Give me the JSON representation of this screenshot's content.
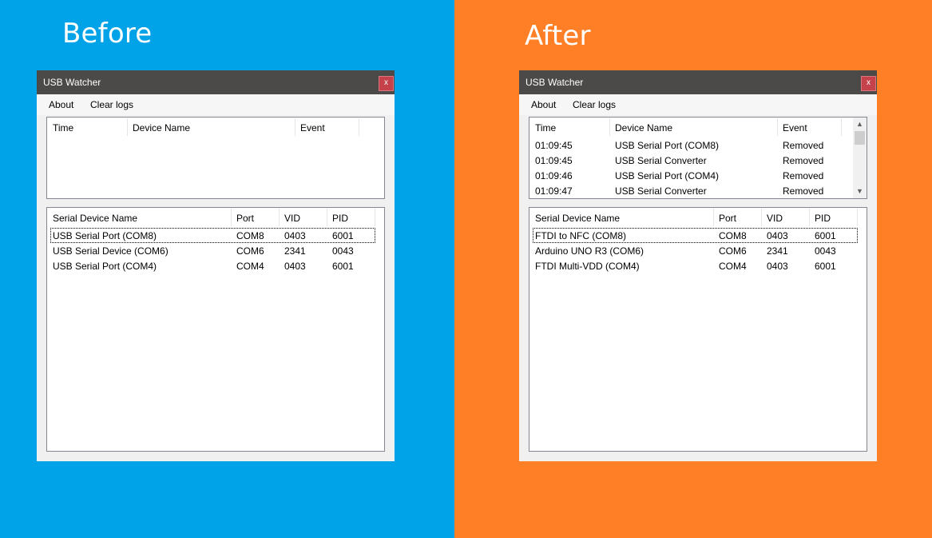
{
  "colors": {
    "before_bg": "#00a2e8",
    "after_bg": "#ff7f27",
    "titlebar": "#4b4a48",
    "close_button": "#c6424a"
  },
  "before": {
    "heading": "Before",
    "window": {
      "title": "USB Watcher",
      "close_label": "x",
      "menu": [
        "About",
        "Clear logs"
      ],
      "events": {
        "columns": [
          "Time",
          "Device Name",
          "Event"
        ],
        "rows": []
      },
      "devices": {
        "columns": [
          "Serial Device Name",
          "Port",
          "VID",
          "PID"
        ],
        "rows": [
          [
            "USB Serial Port (COM8)",
            "COM8",
            "0403",
            "6001"
          ],
          [
            "USB Serial Device (COM6)",
            "COM6",
            "2341",
            "0043"
          ],
          [
            "USB Serial Port (COM4)",
            "COM4",
            "0403",
            "6001"
          ]
        ]
      }
    }
  },
  "after": {
    "heading": "After",
    "window": {
      "title": "USB Watcher",
      "close_label": "x",
      "menu": [
        "About",
        "Clear logs"
      ],
      "events": {
        "columns": [
          "Time",
          "Device Name",
          "Event"
        ],
        "rows": [
          [
            "01:09:45",
            "USB Serial Port (COM8)",
            "Removed"
          ],
          [
            "01:09:45",
            "USB Serial Converter",
            "Removed"
          ],
          [
            "01:09:46",
            "USB Serial Port (COM4)",
            "Removed"
          ],
          [
            "01:09:47",
            "USB Serial Converter",
            "Removed"
          ]
        ],
        "scroll_up_icon": "chevron-up-icon",
        "scroll_down_icon": "chevron-down-icon"
      },
      "devices": {
        "columns": [
          "Serial Device Name",
          "Port",
          "VID",
          "PID"
        ],
        "rows": [
          [
            "FTDI to NFC (COM8)",
            "COM8",
            "0403",
            "6001"
          ],
          [
            "Arduino UNO R3 (COM6)",
            "COM6",
            "2341",
            "0043"
          ],
          [
            "FTDI Multi-VDD (COM4)",
            "COM4",
            "0403",
            "6001"
          ]
        ]
      }
    }
  }
}
